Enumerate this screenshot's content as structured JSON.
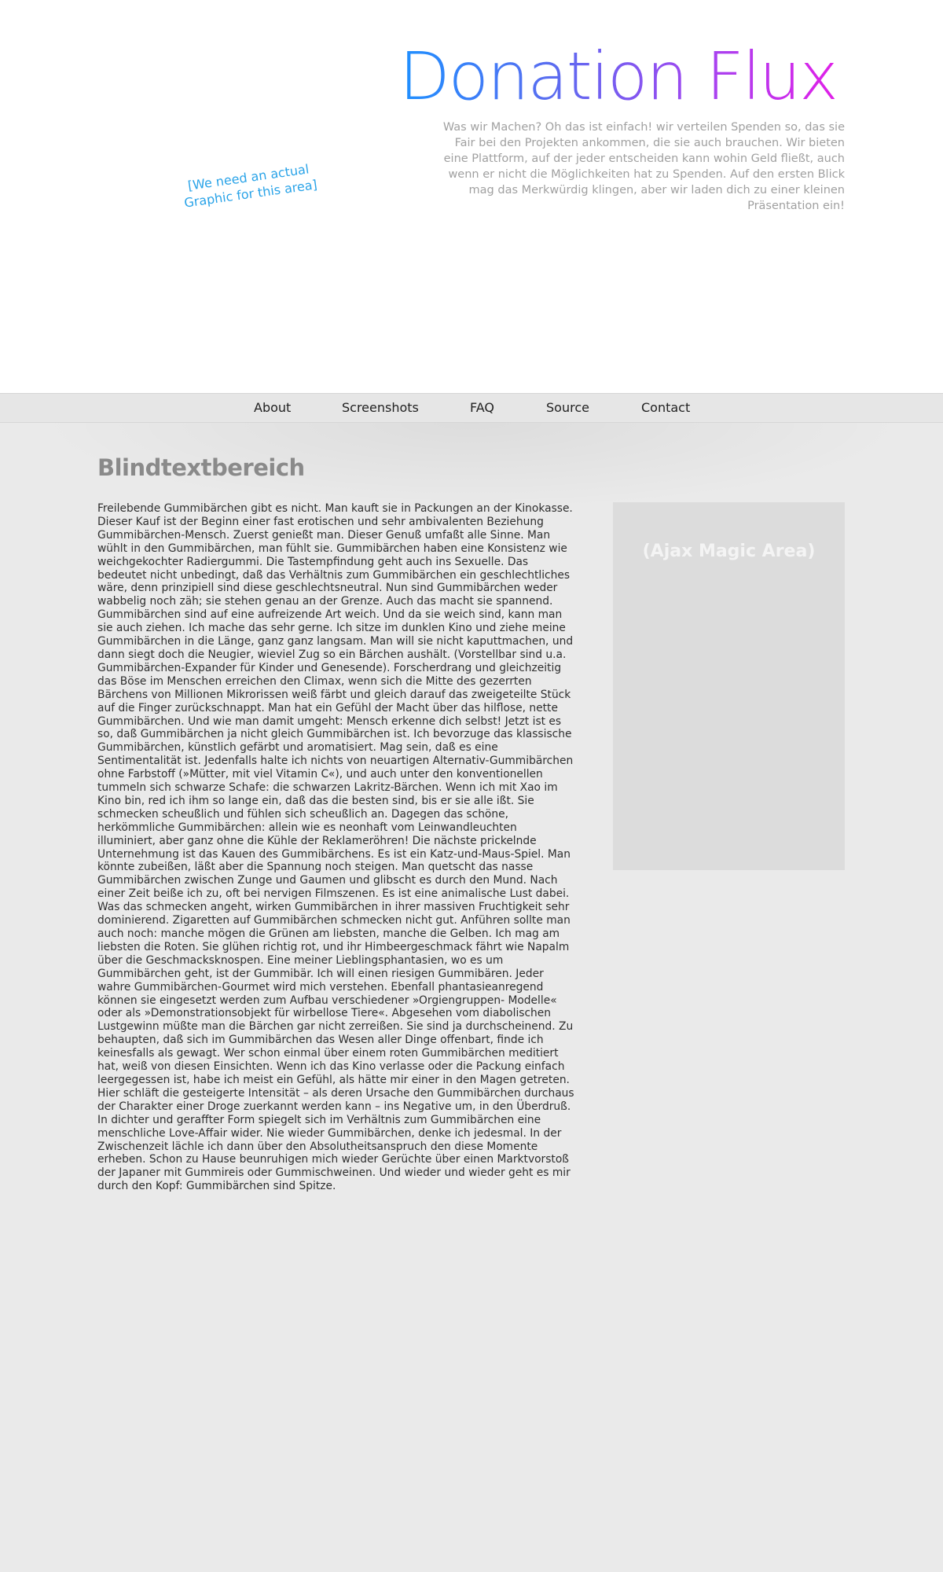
{
  "header": {
    "logo_text": "Donation Flux",
    "graphic_placeholder": "[We need an actual Graphic for this area]",
    "intro_text": "Was wir Machen? Oh das ist einfach! wir verteilen Spenden so, das sie Fair bei den Projekten ankommen, die sie auch brauchen. Wir bieten eine Plattform, auf der jeder entscheiden kann wohin Geld fließt, auch wenn er nicht die Möglichkeiten hat zu Spenden. Auf den ersten Blick mag das Merkwürdig klingen, aber wir laden dich zu einer kleinen Präsentation ein!"
  },
  "nav": {
    "items": [
      {
        "label": "About"
      },
      {
        "label": "Screenshots"
      },
      {
        "label": "FAQ"
      },
      {
        "label": "Source"
      },
      {
        "label": "Contact"
      }
    ]
  },
  "main": {
    "heading": "Blindtextbereich",
    "body": "Freilebende Gummibärchen gibt es nicht. Man kauft sie in Packungen an der Kinokasse. Dieser Kauf ist der Beginn einer fast erotischen und sehr ambivalenten Beziehung Gummibärchen-Mensch. Zuerst genießt man. Dieser Genuß umfaßt alle Sinne. Man wühlt in den Gummibärchen, man fühlt sie. Gummibärchen haben eine Konsistenz wie weichgekochter Radiergummi. Die Tastempfindung geht auch ins Sexuelle. Das bedeutet nicht unbedingt, daß das Verhältnis zum Gummibärchen ein geschlechtliches wäre, denn prinzipiell sind diese geschlechtsneutral. Nun sind Gummibärchen weder wabbelig noch zäh; sie stehen genau an der Grenze. Auch das macht sie spannend. Gummibärchen sind auf eine aufreizende Art weich. Und da sie weich sind, kann man sie auch ziehen. Ich mache das sehr gerne. Ich sitze im dunklen Kino und ziehe meine Gummibärchen in die Länge, ganz ganz langsam. Man will sie nicht kaputtmachen, und dann siegt doch die Neugier, wieviel Zug so ein Bärchen aushält. (Vorstellbar sind u.a. Gummibärchen-Expander für Kinder und Genesende). Forscherdrang und gleichzeitig das Böse im Menschen erreichen den Climax, wenn sich die Mitte des gezerrten Bärchens von Millionen Mikrorissen weiß färbt und gleich darauf das zweigeteilte Stück auf die Finger zurückschnappt. Man hat ein Gefühl der Macht über das hilflose, nette Gummibärchen. Und wie man damit umgeht: Mensch erkenne dich selbst! Jetzt ist es so, daß Gummibärchen ja nicht gleich Gummibärchen ist. Ich bevorzuge das klassische Gummibärchen, künstlich gefärbt und aromatisiert. Mag sein, daß es eine Sentimentalität ist. Jedenfalls halte ich nichts von neuartigen Alternativ-Gummibärchen ohne Farbstoff (»Mütter, mit viel Vitamin C«), und auch unter den konventionellen tummeln sich schwarze Schafe: die schwarzen Lakritz-Bärchen. Wenn ich mit Xao im Kino bin, red ich ihm so lange ein, daß das die besten sind, bis er sie alle ißt. Sie schmecken scheußlich und fühlen sich scheußlich an. Dagegen das schöne, herkömmliche Gummibärchen: allein wie es neonhaft vom Leinwandleuchten illuminiert, aber ganz ohne die Kühle der Reklameröhren! Die nächste prickelnde Unternehmung ist das Kauen des Gummibärchens. Es ist ein Katz-und-Maus-Spiel. Man könnte zubeißen, läßt aber die Spannung noch steigen. Man quetscht das nasse Gummibärchen zwischen Zunge und Gaumen und glibscht es durch den Mund. Nach einer Zeit beiße ich zu, oft bei nervigen Filmszenen. Es ist eine animalische Lust dabei. Was das schmecken angeht, wirken Gummibärchen in ihrer massiven Fruchtigkeit sehr dominierend. Zigaretten auf Gummibärchen schmecken nicht gut. Anführen sollte man auch noch: manche mögen die Grünen am liebsten, manche die Gelben. Ich mag am liebsten die Roten. Sie glühen richtig rot, und ihr Himbeergeschmack fährt wie Napalm über die Geschmacksknospen. Eine meiner Lieblingsphantasien, wo es um Gummibärchen geht, ist der Gummibär. Ich will einen riesigen Gummibären. Jeder wahre Gummibärchen-Gourmet wird mich verstehen. Ebenfall phantasieanregend können sie eingesetzt werden zum Aufbau verschiedener »Orgiengruppen- Modelle« oder als »Demonstrationsobjekt für wirbellose Tiere«. Abgesehen vom diabolischen Lustgewinn müßte man die Bärchen gar nicht zerreißen. Sie sind ja durchscheinend. Zu behaupten, daß sich im Gummibärchen das Wesen aller Dinge offenbart, finde ich keinesfalls als gewagt. Wer schon einmal über einem roten Gummibärchen meditiert hat, weiß von diesen Einsichten. Wenn ich das Kino verlasse oder die Packung einfach leergegessen ist, habe ich meist ein Gefühl, als hätte mir einer in den Magen getreten. Hier schläft die gesteigerte Intensität – als deren Ursache den Gummibärchen durchaus der Charakter einer Droge zuerkannt werden kann – ins Negative um, in den Überdruß. In dichter und geraffter Form spiegelt sich im Verhältnis zum Gummibärchen eine menschliche Love-Affair wider. Nie wieder Gummibärchen, denke ich jedesmal. In der Zwischenzeit lächle ich dann über den Absolutheitsanspruch den diese Momente erheben. Schon zu Hause beunruhigen mich wieder Gerüchte über einen Marktvorstoß der Japaner mit Gummireis oder Gummischweinen. Und wieder und wieder geht es mir durch den Kopf: Gummibärchen sind Spitze."
  },
  "sidebar": {
    "title": "(Ajax Magic Area)"
  }
}
